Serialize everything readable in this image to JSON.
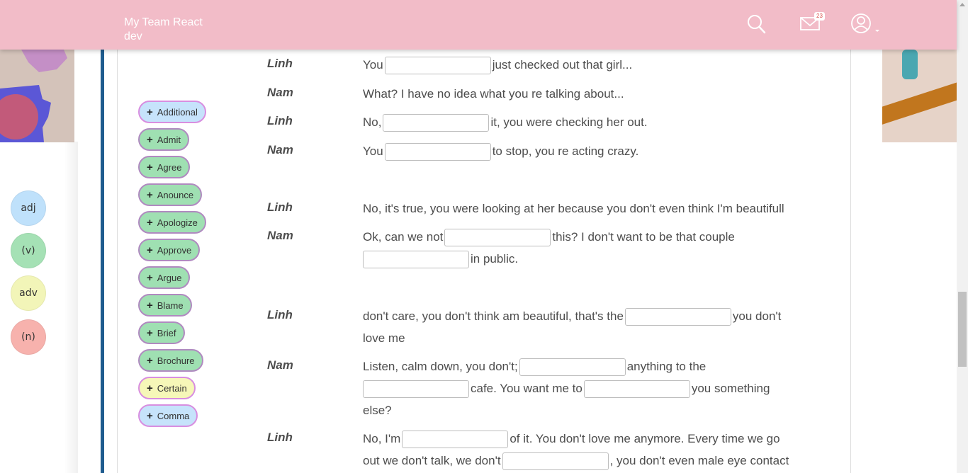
{
  "header": {
    "brand": "My Team React dev",
    "mail_badge": "23"
  },
  "legend": [
    {
      "label": "adj",
      "color": "#bfe1fb"
    },
    {
      "label": "(v)",
      "color": "#a5e1b5"
    },
    {
      "label": "adv",
      "color": "#f2f5b8"
    },
    {
      "label": "(n)",
      "color": "#f7b2ad"
    }
  ],
  "chips": [
    {
      "label": "Additional",
      "color": "blue"
    },
    {
      "label": "Admit",
      "color": "green"
    },
    {
      "label": "Agree",
      "color": "green"
    },
    {
      "label": "Anounce",
      "color": "green"
    },
    {
      "label": "Apologize",
      "color": "green"
    },
    {
      "label": "Approve",
      "color": "green"
    },
    {
      "label": "Argue",
      "color": "green"
    },
    {
      "label": "Blame",
      "color": "green"
    },
    {
      "label": "Brief",
      "color": "green"
    },
    {
      "label": "Brochure",
      "color": "green"
    },
    {
      "label": "Certain",
      "color": "yellow"
    },
    {
      "label": "Comma",
      "color": "blue"
    }
  ],
  "dialogue": [
    {
      "speaker": "Linh",
      "l1a": "You",
      "l1b": "just checked out that girl..."
    },
    {
      "speaker": "Nam",
      "text": "What? I have no idea what you re talking about..."
    },
    {
      "speaker": "Linh",
      "l1a": "No,",
      "l1b": "it, you were checking her out."
    },
    {
      "speaker": "Nam",
      "l1a": "You",
      "l1b": "to stop, you re acting crazy."
    },
    {
      "speaker": "Linh",
      "text": "No, it's true, you were looking at her because you don't even think I'm beautifull"
    },
    {
      "speaker": "Nam",
      "l1a": "Ok, can we not",
      "l1b": "this? I don't want to be that couple",
      "l2b": "in public."
    },
    {
      "speaker": "Linh",
      "l1a": "don't care, you don't think am beautiful, that's the",
      "l1b": "you don't",
      "l2": "love me"
    },
    {
      "speaker": "Nam",
      "l1a": "Listen, calm down, you don't;",
      "l1b": "anything to the",
      "l2b": "cafe. You want me to",
      "l2c": "you something",
      "l3": "else?"
    },
    {
      "speaker": "Linh",
      "l1a": "No, I'm",
      "l1b": "of it. You don't love me anymore. Every time we go",
      "l2a": "out we don't talk, we don't",
      "l2b": ", you don't even male eye contact"
    }
  ]
}
